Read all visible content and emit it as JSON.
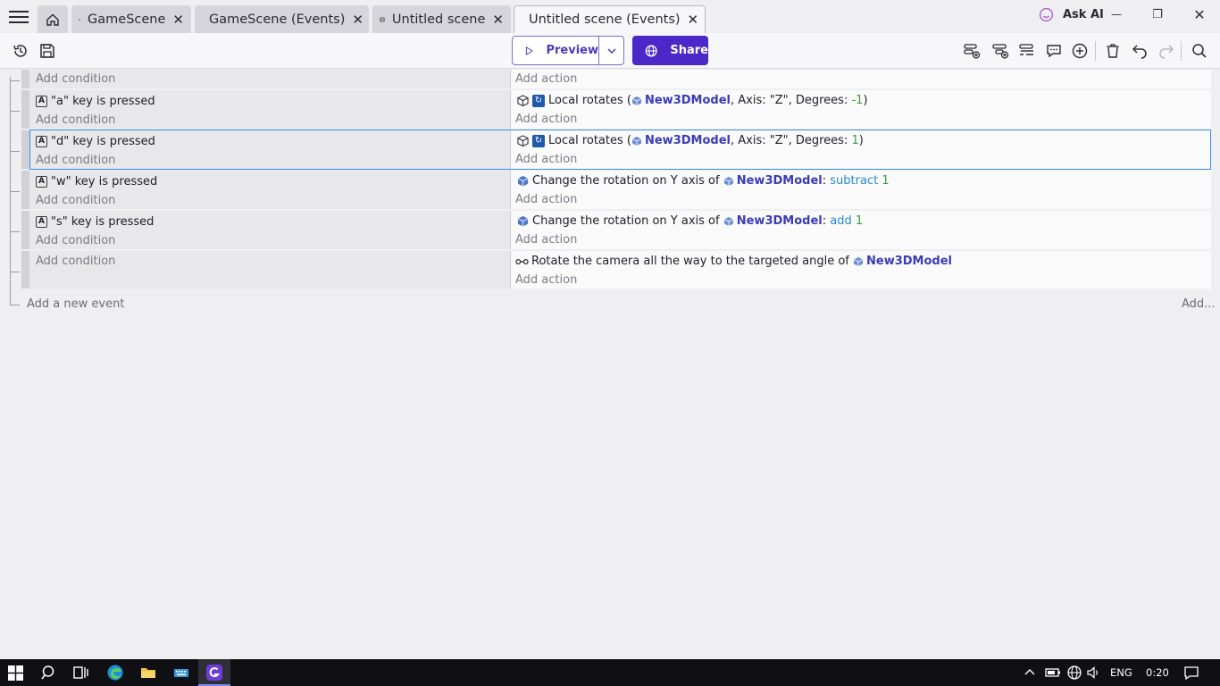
{
  "tabs": [
    {
      "label": "GameScene",
      "kind": "scene"
    },
    {
      "label": "GameScene (Events)",
      "kind": "events"
    },
    {
      "label": "Untitled scene",
      "kind": "scene"
    },
    {
      "label": "Untitled scene (Events)",
      "kind": "events",
      "active": true
    }
  ],
  "titlebar": {
    "ask_ai_label": "Ask AI",
    "minimize": "—",
    "restore": "❐",
    "close": "✕",
    "tab_close": "✕"
  },
  "toolbar": {
    "preview_label": "Preview",
    "preview_dropdown": "⌄",
    "share_label": "Share"
  },
  "events": [
    {
      "condition": null,
      "add_condition": "Add condition",
      "actions": [],
      "add_action": "Add action"
    },
    {
      "condition": {
        "key": "\"a\"",
        "rest": "key is pressed"
      },
      "add_condition": "Add condition",
      "action": {
        "prefix": "Local rotates (",
        "object": "New3DModel",
        "middle": ", Axis: \"Z\", Degrees: ",
        "value": "-1",
        "suffix": ")"
      },
      "add_action": "Add action"
    },
    {
      "condition": {
        "key": "\"d\"",
        "rest": "key is pressed"
      },
      "add_condition": "Add condition",
      "action": {
        "prefix": "Local rotates (",
        "object": "New3DModel",
        "middle": ", Axis: \"Z\", Degrees: ",
        "value": "1",
        "suffix": ")"
      },
      "add_action": "Add action",
      "selected": true
    },
    {
      "condition": {
        "key": "\"w\"",
        "rest": "key is pressed"
      },
      "add_condition": "Add condition",
      "action": {
        "prefix": "Change the rotation on Y axis of ",
        "object": "New3DModel",
        "middle": ": ",
        "op": "subtract",
        "value": "1"
      },
      "add_action": "Add action"
    },
    {
      "condition": {
        "key": "\"s\"",
        "rest": "key is pressed"
      },
      "add_condition": "Add condition",
      "action": {
        "prefix": "Change the rotation on Y axis of ",
        "object": "New3DModel",
        "middle": ": ",
        "op": "add",
        "value": "1"
      },
      "add_action": "Add action"
    },
    {
      "condition": null,
      "add_condition": "Add condition",
      "action": {
        "prefix": "Rotate the camera all the way to the targeted angle of ",
        "object": "New3DModel"
      },
      "add_action": "Add action"
    }
  ],
  "footer": {
    "add_event": "Add a new event",
    "add_more": "Add..."
  },
  "taskbar": {
    "language": "ENG",
    "time": "0:20"
  },
  "colors": {
    "accent": "#4b28c7",
    "object_name": "#3b3bb5",
    "operator": "#2a8ac7",
    "number": "#3d9a3d",
    "selection": "#3a8ee6"
  }
}
